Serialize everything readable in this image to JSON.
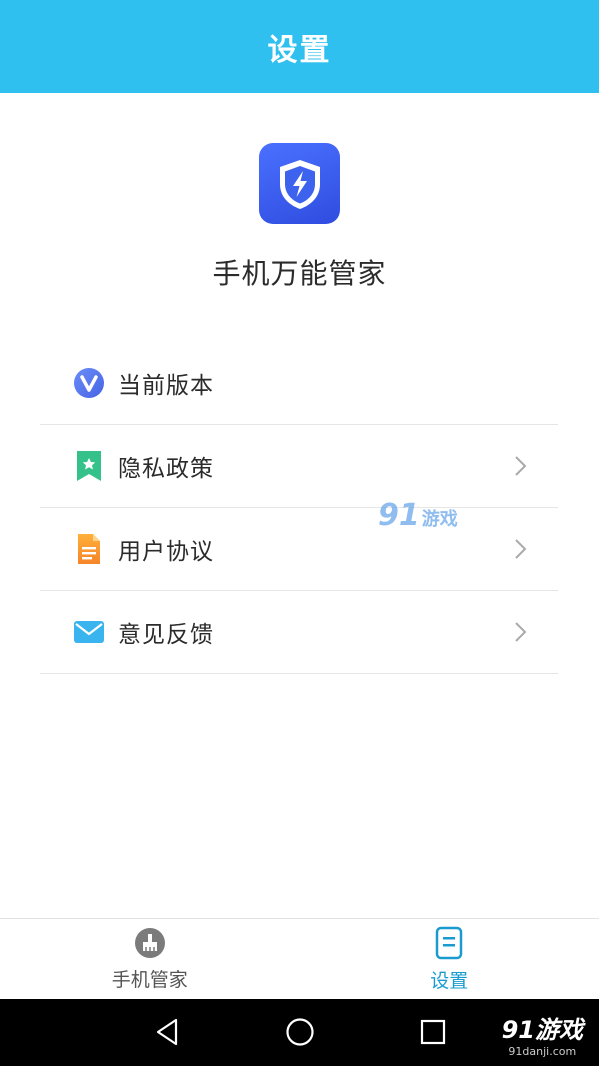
{
  "header": {
    "title": "设置"
  },
  "app": {
    "name": "手机万能管家"
  },
  "menu": {
    "items": [
      {
        "label": "当前版本",
        "icon": "v-logo-icon",
        "value": "",
        "has_chevron": false
      },
      {
        "label": "隐私政策",
        "icon": "bookmark-star-icon",
        "has_chevron": true
      },
      {
        "label": "用户协议",
        "icon": "document-icon",
        "has_chevron": true
      },
      {
        "label": "意见反馈",
        "icon": "mail-icon",
        "has_chevron": true
      }
    ]
  },
  "tabbar": {
    "tabs": [
      {
        "label": "手机管家",
        "icon": "broom-icon",
        "active": false
      },
      {
        "label": "设置",
        "icon": "settings-doc-icon",
        "active": true
      }
    ]
  },
  "watermark": {
    "brand": "91游戏",
    "url": "91danji.com",
    "center_text": "游戏",
    "center_num": "91"
  },
  "colors": {
    "header": "#2fc0f0",
    "active_tab": "#1a9bd0",
    "logo": "#3a5cf0"
  }
}
